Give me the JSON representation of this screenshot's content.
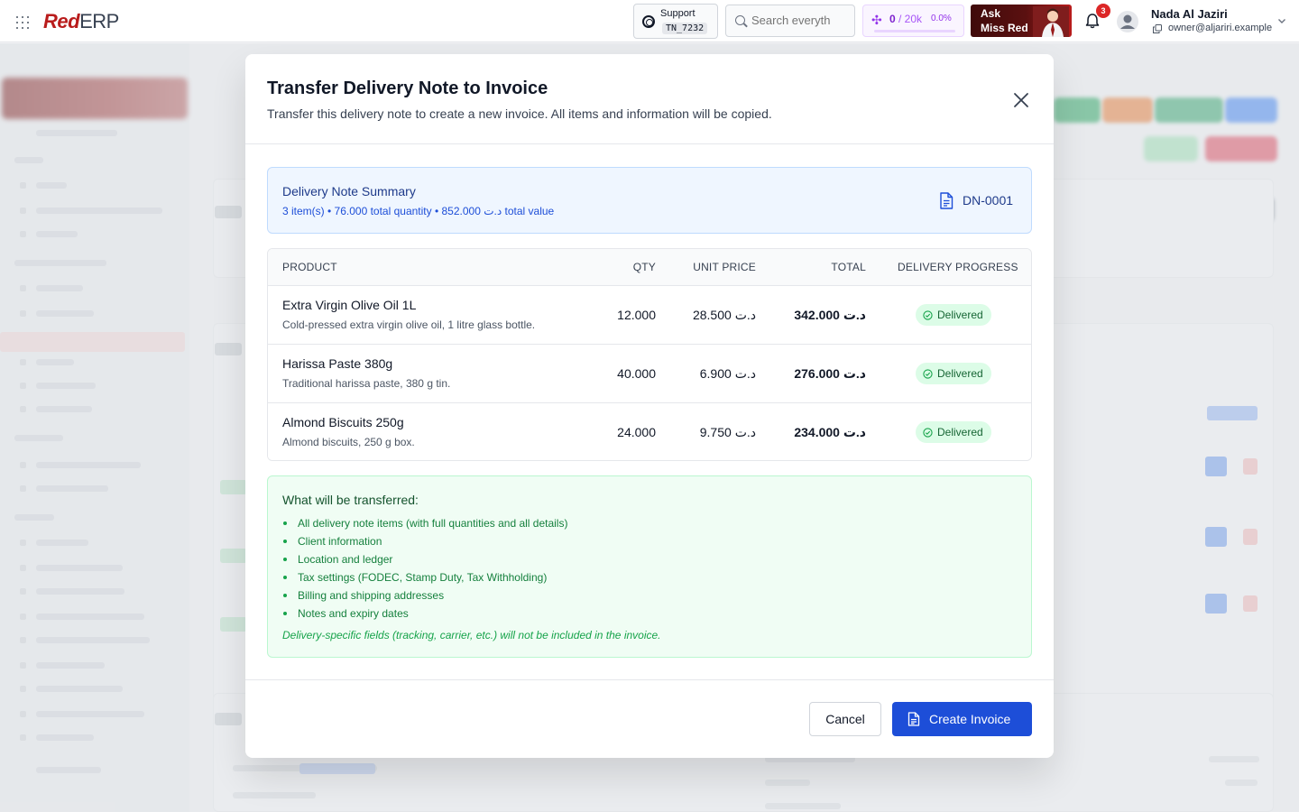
{
  "app": {
    "brand_red": "Red",
    "brand_rest": "ERP",
    "support": {
      "label": "Support",
      "code": "TN_7232"
    },
    "search": {
      "placeholder": "Search everyth"
    },
    "credits": {
      "used": "0",
      "limit": "/ 20k",
      "percent": "0.0%",
      "fill_fraction": 0.0
    },
    "ask": {
      "line1": "Ask",
      "line2": "Miss Red"
    },
    "notifications": {
      "count": "3"
    },
    "user": {
      "name": "Nada Al Jaziri",
      "email": "owner@aljariri.example"
    }
  },
  "modal": {
    "title": "Transfer Delivery Note to Invoice",
    "subtitle": "Transfer this delivery note to create a new invoice. All items and information will be copied.",
    "summary": {
      "title": "Delivery Note Summary",
      "line": "3 item(s) • 76.000 total quantity • 852.000 د.ت total value",
      "number": "DN-0001"
    },
    "table": {
      "headers": {
        "product": "PRODUCT",
        "qty": "QTY",
        "unit_price": "UNIT PRICE",
        "total": "TOTAL",
        "progress": "DELIVERY PROGRESS"
      },
      "rows": [
        {
          "name": "Extra Virgin Olive Oil 1L",
          "description": "Cold-pressed extra virgin olive oil, 1 litre glass bottle.",
          "qty": "12.000",
          "unit_price": "28.500 د.ت",
          "total": "342.000 د.ت",
          "status": "Delivered"
        },
        {
          "name": "Harissa Paste 380g",
          "description": "Traditional harissa paste, 380 g tin.",
          "qty": "40.000",
          "unit_price": "6.900 د.ت",
          "total": "276.000 د.ت",
          "status": "Delivered"
        },
        {
          "name": "Almond Biscuits 250g",
          "description": "Almond biscuits, 250 g box.",
          "qty": "24.000",
          "unit_price": "9.750 د.ت",
          "total": "234.000 د.ت",
          "status": "Delivered"
        }
      ]
    },
    "transfer": {
      "title": "What will be transferred:",
      "items": [
        "All delivery note items (with full quantities and all details)",
        "Client information",
        "Location and ledger",
        "Tax settings (FODEC, Stamp Duty, Tax Withholding)",
        "Billing and shipping addresses",
        "Notes and expiry dates"
      ],
      "note": "Delivery-specific fields (tracking, carrier, etc.) will not be included in the invoice."
    },
    "buttons": {
      "cancel": "Cancel",
      "create": "Create Invoice"
    }
  },
  "colors": {
    "brand_red": "#b91c1c",
    "primary_blue": "#1d4ed8",
    "success_green": "#16a34a",
    "info_bg": "#eff6ff",
    "success_bg": "#f0fdf4"
  },
  "icons": [
    "apps-grid-icon",
    "lifebuoy-icon",
    "search-icon",
    "sparkle-icon",
    "bell-icon",
    "user-avatar-icon",
    "copy-icon",
    "chevron-down-icon",
    "close-icon",
    "document-icon",
    "check-circle-icon"
  ]
}
